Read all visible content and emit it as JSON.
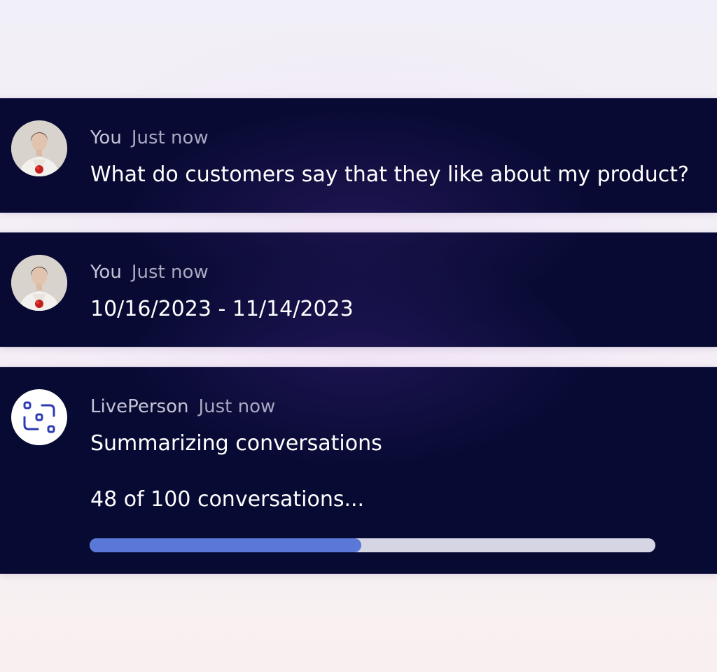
{
  "messages": [
    {
      "sender": "You",
      "time": "Just now",
      "text": "What do customers say that they like about my product?"
    },
    {
      "sender": "You",
      "time": "Just now",
      "text": "10/16/2023 - 11/14/2023"
    },
    {
      "sender": "LivePerson",
      "time": "Just now",
      "text": "Summarizing conversations",
      "progress_text": "48 of 100 conversations...",
      "progress_fraction": 0.48
    }
  ],
  "colors": {
    "card_background": "#080a33",
    "progress_fill": "#5a78d8",
    "progress_track": "#d5d5e3",
    "bot_icon": "#2f3bb0"
  },
  "icons": {
    "user_avatar": "user-avatar-photo",
    "bot_avatar": "liveperson-bot-icon"
  }
}
